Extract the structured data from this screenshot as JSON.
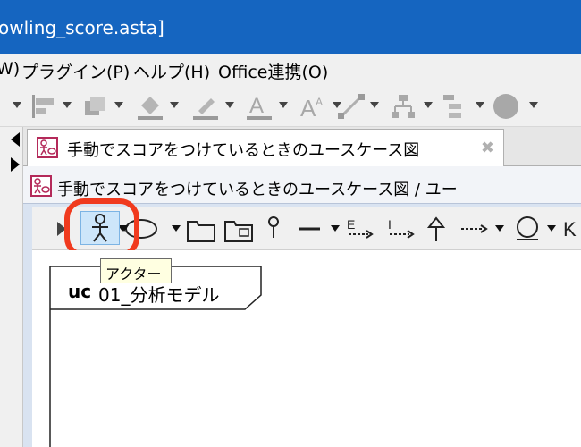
{
  "window": {
    "title": "owling_score.asta]"
  },
  "menubar": {
    "items": [
      {
        "label": "W)"
      },
      {
        "label": "プラグイン(P)"
      },
      {
        "label": "ヘルプ(H)"
      },
      {
        "label": "Office連携(O)"
      }
    ]
  },
  "toolbar_main": {
    "icons": [
      "align-icon",
      "arrange-icon",
      "fill-color-icon",
      "line-color-icon",
      "font-color-icon",
      "font-size-icon",
      "line-style-icon",
      "tree-layout-icon",
      "list-layout-icon",
      "emoji-icon"
    ]
  },
  "tabs": [
    {
      "label": "手動でスコアをつけているときのユースケース図",
      "active": true
    }
  ],
  "inner_window": {
    "title": "手動でスコアをつけているときのユースケース図 / ユー"
  },
  "diagram_toolbar": {
    "tools": [
      "select-tool-icon",
      "actor-tool-icon",
      "usecase-tool-icon",
      "package-tool-icon",
      "subsystem-tool-icon",
      "interface-tool-icon",
      "association-tool-icon",
      "extend-tool-icon",
      "include-tool-icon",
      "generalization-tool-icon",
      "dependency-tool-icon",
      "note-tool-icon",
      "more-tool-icon"
    ],
    "highlighted": "actor-tool-icon",
    "tooltip": "アクター"
  },
  "diagram": {
    "frame_keyword": "uc",
    "frame_name": "01_分析モデル"
  },
  "colors": {
    "titlebar": "#1565c0",
    "highlight_ring": "#f03a1e",
    "tooltip_bg": "#ffffe1"
  }
}
